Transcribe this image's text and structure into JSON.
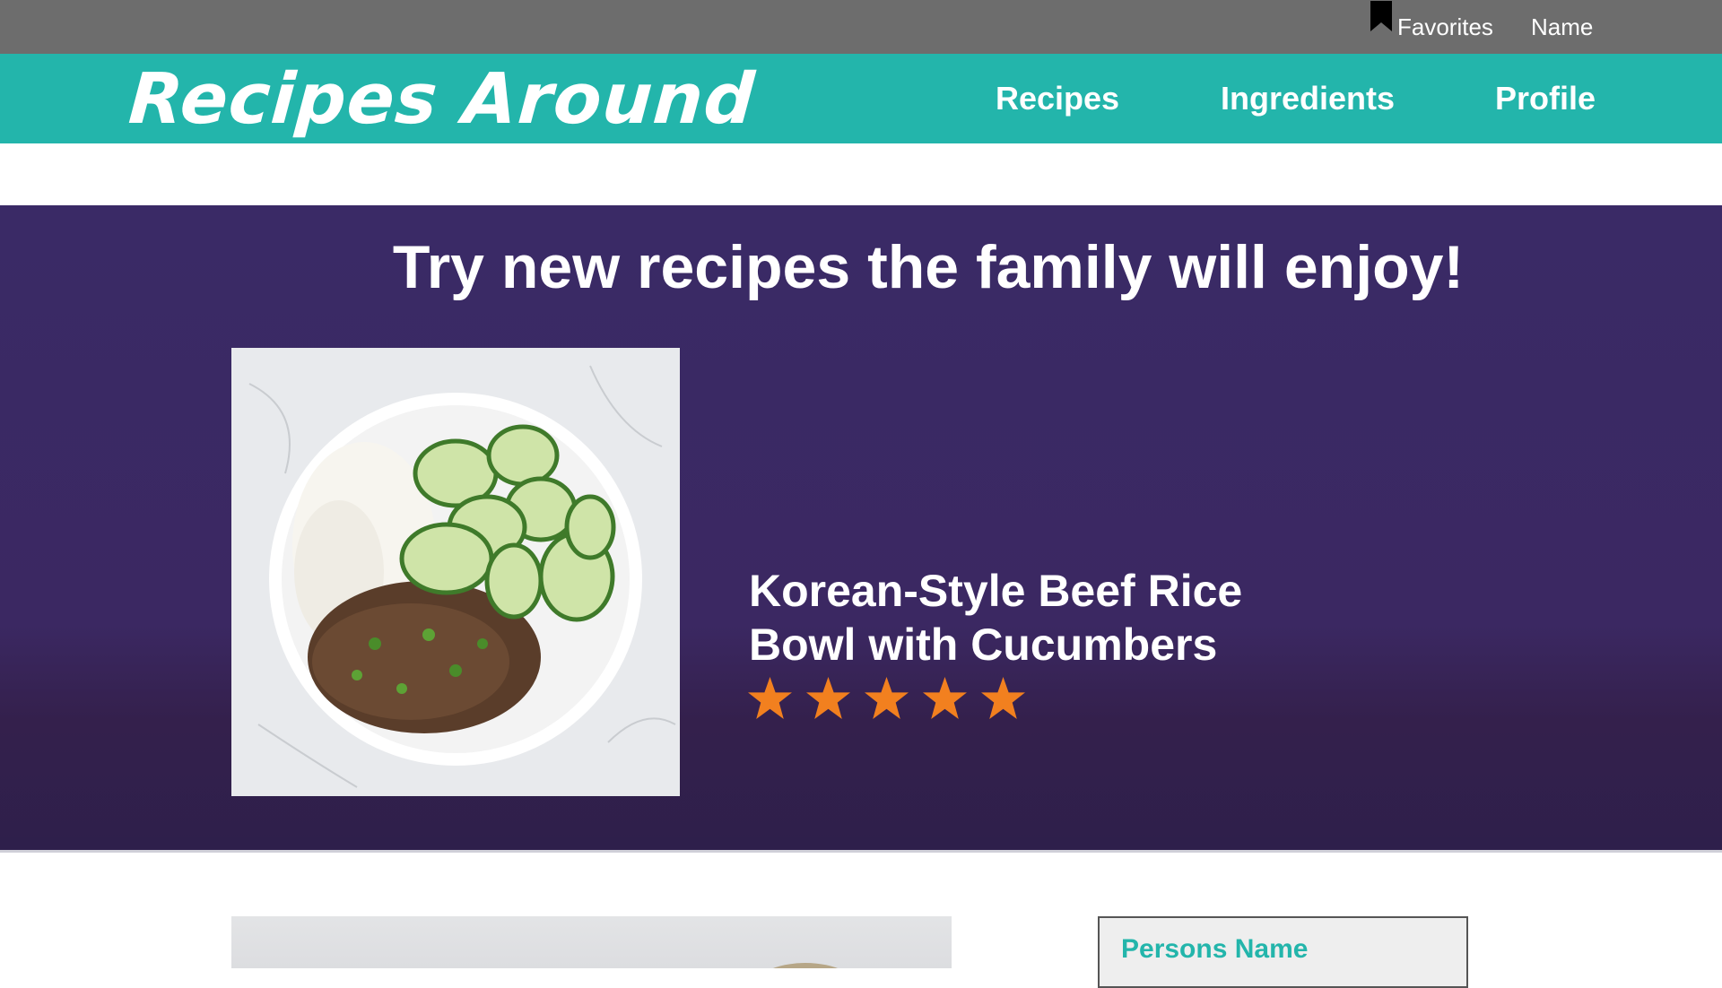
{
  "top_bar": {
    "favorites_icon": "bookmark-icon",
    "favorites_label": "Favorites",
    "name_label": "Name"
  },
  "nav": {
    "logo": "Recipes Around",
    "links": [
      "Recipes",
      "Ingredients",
      "Profile"
    ]
  },
  "hero": {
    "title": "Try new recipes the family will enjoy!",
    "image_alt": "Korean-style beef rice bowl with cucumbers",
    "recipe_title": "Korean-Style Beef Rice Bowl with Cucumbers",
    "rating": 5,
    "rating_max": 5,
    "star_icon": "star-icon"
  },
  "profile_card": {
    "name": "Persons Name"
  },
  "colors": {
    "top_bar": "#6d6d6d",
    "nav_bar": "#23b5ab",
    "hero_bg": "#3a2a66",
    "star": "#f2801f",
    "accent_text": "#23b5ab"
  }
}
